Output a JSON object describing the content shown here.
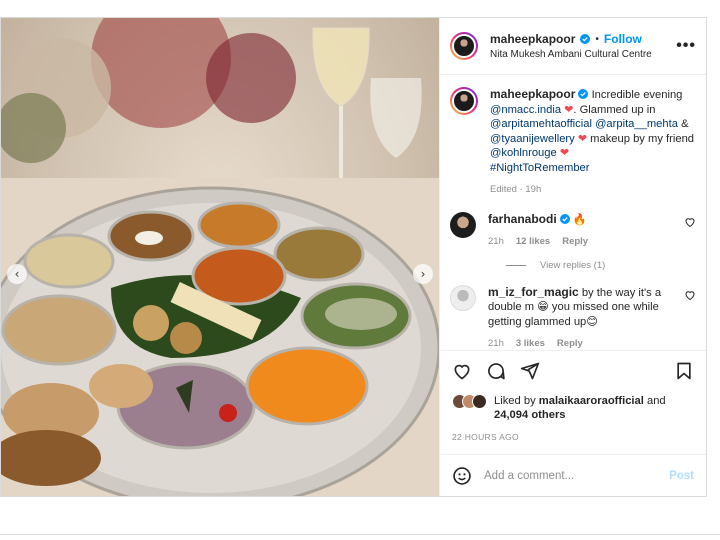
{
  "header": {
    "username": "maheepkapoor",
    "follow_label": "Follow",
    "location": "Nita Mukesh Ambani Cultural Centre",
    "more_label": "•••"
  },
  "caption": {
    "username": "maheepkapoor",
    "text1": "Incredible evening",
    "mention1": "@nmacc.india",
    "text2": ". Glammed up in",
    "mention2": "@arpitamehtaofficial",
    "mention3": "@arpita__mehta",
    "text3": "&",
    "mention4": "@tyaanijewellery",
    "text4": "makeup by my friend",
    "mention5": "@kohlnrouge",
    "hashtag": "#NightToRemember",
    "edited": "Edited · 19h"
  },
  "comments": [
    {
      "username": "farhanabodi",
      "text": "🔥",
      "time": "21h",
      "likes": "12 likes",
      "reply": "Reply"
    },
    {
      "username": "m_iz_for_magic",
      "text": "by the way it's a double m 😁 you missed one while getting glammed up😊",
      "time": "21h",
      "likes": "3 likes",
      "reply": "Reply"
    }
  ],
  "view_replies": "View replies (1)",
  "likes": {
    "prefix": "Liked by",
    "user": "malaikaaroraofficial",
    "and": "and",
    "count": "24,094 others"
  },
  "timestamp": "22 HOURS AGO",
  "add_comment": {
    "placeholder": "Add a comment...",
    "post_label": "Post"
  },
  "icons": {
    "verified": "verified-badge-icon",
    "like": "heart-icon",
    "comment": "comment-icon",
    "share": "share-icon",
    "save": "bookmark-icon",
    "emoji": "emoji-icon",
    "prev": "chevron-left-icon",
    "next": "chevron-right-icon"
  },
  "colors": {
    "accent": "#0095f6",
    "mention": "#00376b",
    "muted": "#8e8e8e",
    "heart": "#ed4956"
  }
}
